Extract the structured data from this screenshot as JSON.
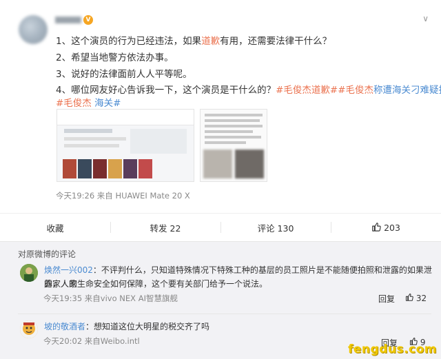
{
  "post": {
    "lines": [
      {
        "pre": "1、这个演员的行为已经违法，如果",
        "hl": "道歉",
        "post": "有用，还需要法律干什么？"
      },
      {
        "text": "2、希望当地警方依法办事。"
      },
      {
        "text": "3、说好的法律面前人人平等呢。"
      },
      {
        "pre": "4、哪位网友好心告诉我一下，这个演员是干什么的？",
        "tag1": "#毛俊杰道歉#",
        "tag2": "#毛俊杰",
        "link2": "称遭海关刁难疑打脸"
      }
    ],
    "line5": {
      "tag": "#毛俊杰",
      "link": " 海关#"
    },
    "meta": "今天19:26 来自 HUAWEI Mate 20 X",
    "actions": {
      "collect": "收藏",
      "repost": "转发 22",
      "comment": "评论 130",
      "like": "203"
    }
  },
  "comments_section": {
    "title": "对原微博的评论",
    "items": [
      {
        "user": "焕然一兴002",
        "text1": "：不评判什么，只知道特殊情况下特殊工种的基层的员工照片是不能随便拍照和泄露的如果泄露，人家",
        "text2": "的家人的生命安全如何保障，这个要有关部门给予一个说法。",
        "meta": "今天19:35 来自vivo NEX AI智慧旗舰",
        "reply": "回复",
        "likes": "32"
      },
      {
        "user": "坡的敬酒者",
        "text1": "：想知道这位大明星的税交齐了吗",
        "meta": "今天20:02 来自Weibo.intl",
        "reply": "回复",
        "likes": "9"
      }
    ]
  },
  "watermark": "fengdus.com",
  "colors": {
    "accent": "#eb7350",
    "link": "#4b8bd1",
    "watermark": "#f0c800"
  }
}
